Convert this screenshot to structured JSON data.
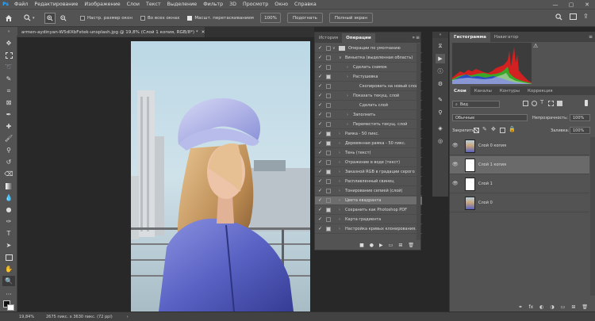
{
  "menubar": {
    "logo": "Ps",
    "items": [
      "Файл",
      "Редактирование",
      "Изображение",
      "Слои",
      "Текст",
      "Выделение",
      "Фильтр",
      "3D",
      "Просмотр",
      "Окно",
      "Справка"
    ],
    "minimize": "—",
    "maximize": "▢",
    "close": "✕"
  },
  "options": {
    "resize_windows_label": "Настр. размер окон",
    "all_windows_label": "Во всех окнах",
    "scrubby_zoom_label": "Масшт. перетаскиванием",
    "zoom_value": "100%",
    "fit_button": "Подогнать",
    "fullscreen_button": "Полный экран"
  },
  "document": {
    "tab_title": "armen-aydinyan-W5dIXbFxtek-unsplash.jpg @ 19,8% (Слой 1 копия, RGB/8*) *",
    "close": "✕"
  },
  "status": {
    "zoom": "19,84%",
    "info": "2675 пикс. x 3630 пикс. (72 ppi)",
    "arrow": "›"
  },
  "history_panel": {
    "tabs": [
      "История",
      "Операции"
    ],
    "active_tab": 1,
    "collapse": "»",
    "menu": "≡",
    "rows": [
      {
        "label": "Операции по умолчанию",
        "level": 0,
        "folder": true,
        "checked": true
      },
      {
        "label": "Виньетка (выделенная область)",
        "level": 1,
        "checked": true
      },
      {
        "label": "Сделать снимок",
        "level": 2,
        "checked": true
      },
      {
        "label": "Растушевка",
        "level": 2,
        "checked": true,
        "dialog": true
      },
      {
        "label": "Скопировать на новый слой",
        "level": 3,
        "checked": true
      },
      {
        "label": "Показать текущ. слой",
        "level": 2,
        "checked": true
      },
      {
        "label": "Сделать слой",
        "level": 3,
        "checked": true
      },
      {
        "label": "Заполнить",
        "level": 2,
        "checked": true
      },
      {
        "label": "Переместить текущ. слой",
        "level": 2,
        "checked": true
      },
      {
        "label": "Рамка - 50 пикс.",
        "level": 1,
        "checked": true,
        "dialog": true
      },
      {
        "label": "Деревянная рамка - 50 пикс.",
        "level": 1,
        "checked": true,
        "dialog": true
      },
      {
        "label": "Тень (текст)",
        "level": 1,
        "checked": true
      },
      {
        "label": "Отражение в воде (текст)",
        "level": 1,
        "checked": true
      },
      {
        "label": "Заказной RGB в градации серого",
        "level": 1,
        "checked": true,
        "dialog": true
      },
      {
        "label": "Расплавленный свинец",
        "level": 1,
        "checked": true
      },
      {
        "label": "Тонирование сепией (слой)",
        "level": 1,
        "checked": true
      },
      {
        "label": "Цвета квадранта",
        "level": 1,
        "checked": true,
        "selected": true
      },
      {
        "label": "Сохранить как Photoshop PDF",
        "level": 1,
        "checked": true,
        "dialog": true
      },
      {
        "label": "Карта градиента",
        "level": 1,
        "checked": true
      },
      {
        "label": "Настройка кривых клонирования...",
        "level": 1,
        "checked": true,
        "dialog": true
      }
    ],
    "bottom_icons": [
      "■",
      "●",
      "▶",
      "▭",
      "⊞",
      "🗑"
    ]
  },
  "histogram_panel": {
    "tabs": [
      "Гистограмма",
      "Навигатор"
    ],
    "collapse": "«",
    "menu": "≡"
  },
  "layers_panel": {
    "tabs": [
      "Слои",
      "Каналы",
      "Контуры",
      "Коррекция"
    ],
    "filter_label": "Вид",
    "blend_mode": "Обычные",
    "opacity_label": "Непрозрачность:",
    "opacity_value": "100%",
    "lock_label": "Закрепить:",
    "fill_label": "Заливка:",
    "fill_value": "100%",
    "layers": [
      {
        "name": "Слой 0 копия",
        "visible": true,
        "thumb": "photo"
      },
      {
        "name": "Слой 1 копия",
        "visible": true,
        "thumb": "white",
        "selected": true
      },
      {
        "name": "Слой 1",
        "visible": true,
        "thumb": "white"
      },
      {
        "name": "Слой 0",
        "visible": false,
        "thumb": "photo"
      }
    ],
    "bottom_icons": [
      "⚭",
      "fx",
      "◐",
      "◑",
      "▭",
      "⊞",
      "🗑"
    ]
  },
  "icon_strip": [
    "history-icon",
    "play-icon",
    "info-icon",
    "adjust-icon",
    "brush-settings-icon",
    "clone-source-icon",
    "layers-icon",
    "channels-icon"
  ]
}
